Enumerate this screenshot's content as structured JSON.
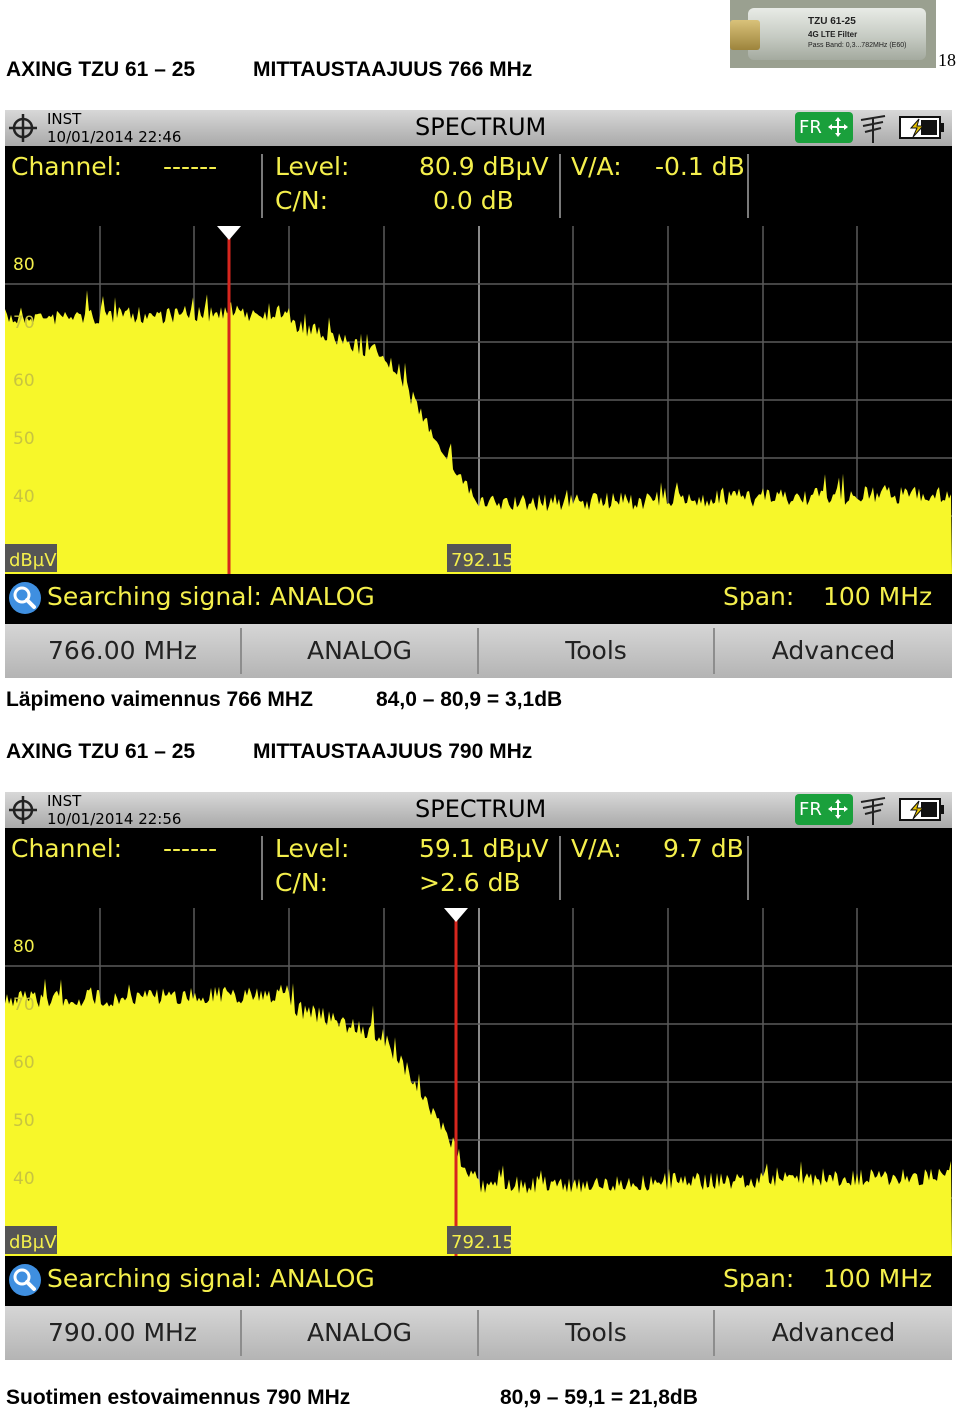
{
  "page_number": "18",
  "product_photo": {
    "model_text": "TZU 61-25",
    "line2": "4G LTE Filter",
    "line3": "Pass Band: 0,3...782MHz (E60)"
  },
  "sections": [
    {
      "heading_left": "AXING TZU 61 – 25",
      "heading_right": "MITTAUSTAAJUUS 766 MHz",
      "screen": {
        "mode": "INST",
        "datetime": "10/01/2014 22:46",
        "title": "SPECTRUM",
        "fr_label": "FR",
        "channel_label": "Channel:",
        "channel_value": "------",
        "level_label": "Level:",
        "level_value": "80.9 dBµV",
        "cn_label": "C/N:",
        "cn_value": "0.0 dB",
        "va_label": "V/A:",
        "va_value": "-0.1 dB",
        "y_ticks": [
          "80",
          "70",
          "60",
          "50",
          "40"
        ],
        "unit_label": "dBµV",
        "center_label": "792.15",
        "marker_fraction": 0.237,
        "search_text": "Searching signal: ANALOG",
        "span_label": "Span:",
        "span_value": "100 MHz",
        "buttons": [
          "766.00 MHz",
          "ANALOG",
          "Tools",
          "Advanced"
        ]
      },
      "caption_left": "Läpimeno vaimennus 766 MHZ",
      "caption_right": "84,0 – 80,9 = 3,1dB"
    },
    {
      "heading_left": "AXING TZU 61 – 25",
      "heading_right": "MITTAUSTAAJUUS 790 MHz",
      "screen": {
        "mode": "INST",
        "datetime": "10/01/2014 22:56",
        "title": "SPECTRUM",
        "fr_label": "FR",
        "channel_label": "Channel:",
        "channel_value": "------",
        "level_label": "Level:",
        "level_value": "59.1 dBµV",
        "cn_label": "C/N:",
        "cn_value": ">2.6 dB",
        "va_label": "V/A:",
        "va_value": "9.7 dB",
        "y_ticks": [
          "80",
          "70",
          "60",
          "50",
          "40"
        ],
        "unit_label": "dBµV",
        "center_label": "792.15",
        "marker_fraction": 0.476,
        "search_text": "Searching signal: ANALOG",
        "span_label": "Span:",
        "span_value": "100 MHz",
        "buttons": [
          "790.00 MHz",
          "ANALOG",
          "Tools",
          "Advanced"
        ]
      },
      "caption_left": "Suotimen estovaimennus 790 MHz",
      "caption_right": "80,9 – 59,1 = 21,8dB"
    }
  ],
  "colors": {
    "trace": "#f7f72a",
    "marker": "#d7261e",
    "text_yellow": "#f4ef4c",
    "grid": "#5a5a5a",
    "fr_green": "#1aa03c"
  }
}
